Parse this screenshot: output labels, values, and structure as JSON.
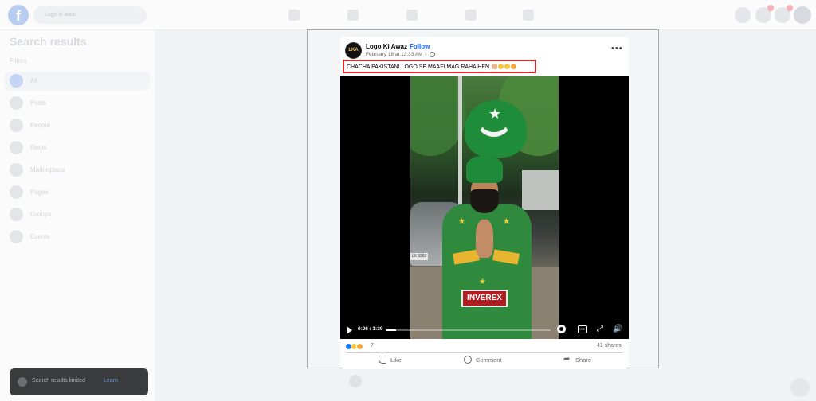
{
  "topbar": {
    "logo": "f",
    "search_placeholder": "Logo ki awaz"
  },
  "sidebar": {
    "title": "Search results",
    "filters_label": "Filters",
    "items": [
      {
        "label": "All"
      },
      {
        "label": "Posts"
      },
      {
        "label": "People"
      },
      {
        "label": "Reels"
      },
      {
        "label": "Marketplace"
      },
      {
        "label": "Pages"
      },
      {
        "label": "Groups"
      },
      {
        "label": "Events"
      }
    ],
    "bottom_banner": {
      "text": "Search results limited",
      "link": "Learn"
    }
  },
  "post": {
    "page_avatar_text": "LKA",
    "page_name": "Logo Ki Awaz",
    "separator": "·",
    "follow_label": "Follow",
    "date": "February 16 at 12:33 AM ·",
    "more_label": "•••",
    "caption": "CHACHA PAKISTANI LOGO SE MAAFI MAG RAHA HEN",
    "video": {
      "time": "0:06 / 1:39",
      "progress": 0.06,
      "plate_text": "LX 3263",
      "logo_band_text": "INVEREX",
      "cc_label": "CC"
    },
    "reaction_count": "7",
    "shares": "41 shares",
    "actions": {
      "like": "Like",
      "comment": "Comment",
      "share": "Share"
    }
  },
  "colors": {
    "accent": "#0866ff",
    "highlight_border": "#e0252b",
    "background": "#f0f2f5"
  },
  "icons": {
    "more": "more-icon",
    "globe": "globe-icon",
    "play": "play-icon",
    "gear": "gear-icon",
    "cc": "cc-icon",
    "expand": "expand-icon",
    "volume": "volume-icon"
  }
}
